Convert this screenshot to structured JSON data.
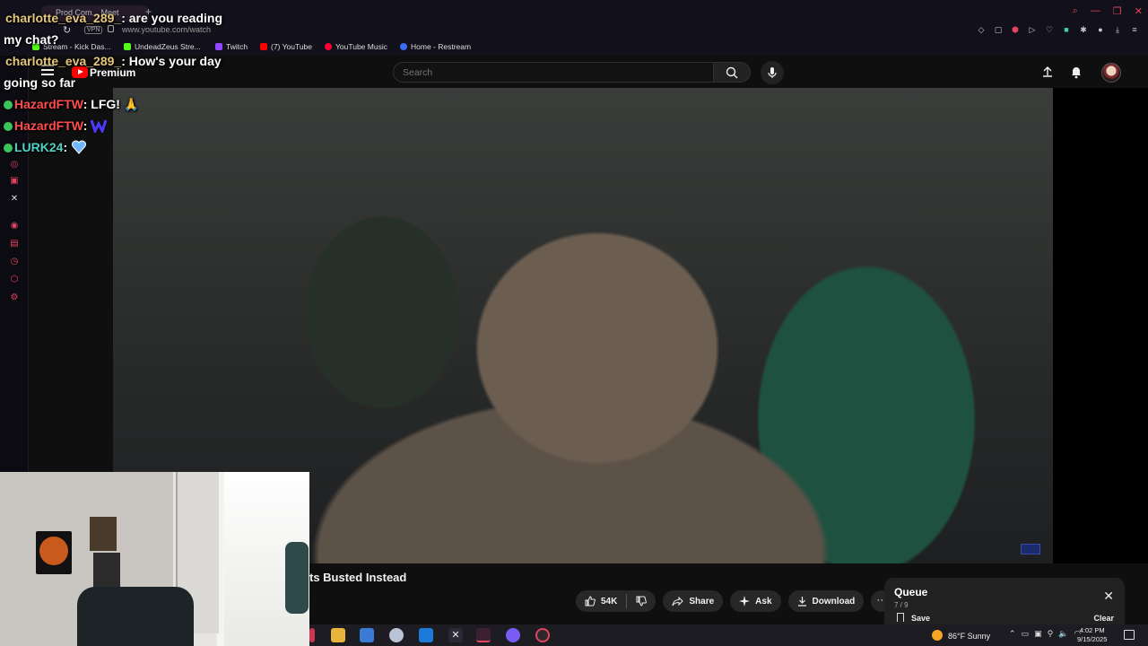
{
  "browser": {
    "tab_title": "Prod Com... Meet",
    "url": "www.youtube.com/watch",
    "vpn_label": "VPN",
    "bookmarks": [
      {
        "label": "Stream - Kick Das...",
        "color": "#53fc18"
      },
      {
        "label": "UndeadZeus Stre...",
        "color": "#53fc18"
      },
      {
        "label": "Twitch",
        "color": "#9146ff"
      },
      {
        "label": "(7) YouTube",
        "color": "#ff0000"
      },
      {
        "label": "YouTube Music",
        "color": "#ff0033"
      },
      {
        "label": "Home - Restream",
        "color": "#3a6cf4"
      }
    ]
  },
  "youtube": {
    "premium_label": "Premium",
    "search_placeholder": "Search"
  },
  "chat": [
    {
      "user": "charlotte_eva_289_",
      "text": ": are you reading",
      "cont": "my chat?",
      "color": "gold"
    },
    {
      "user": "charlotte_eva_289_",
      "text": ": How's your day",
      "cont": "going so far",
      "color": "gold"
    },
    {
      "user": "HazardFTW",
      "text": ": LFG! 🙏",
      "color": "red"
    },
    {
      "user": "HazardFTW",
      "text": ":",
      "color": "red"
    },
    {
      "user": "LURK24",
      "text": ":",
      "color": "teal"
    }
  ],
  "video": {
    "title_partial": "ts Busted Instead"
  },
  "actions": {
    "likes": "54K",
    "share": "Share",
    "ask": "Ask",
    "download": "Download"
  },
  "queue": {
    "title": "Queue",
    "count": "7 / 9",
    "save": "Save",
    "clear": "Clear"
  },
  "taskbar": {
    "temp": "86°F",
    "weather": "Sunny",
    "time": "4:02 PM",
    "date": "9/15/2025"
  },
  "colors": {
    "accent_red": "#ff0000",
    "browser_accent": "#e0445e",
    "bg": "#0f0f0f"
  }
}
